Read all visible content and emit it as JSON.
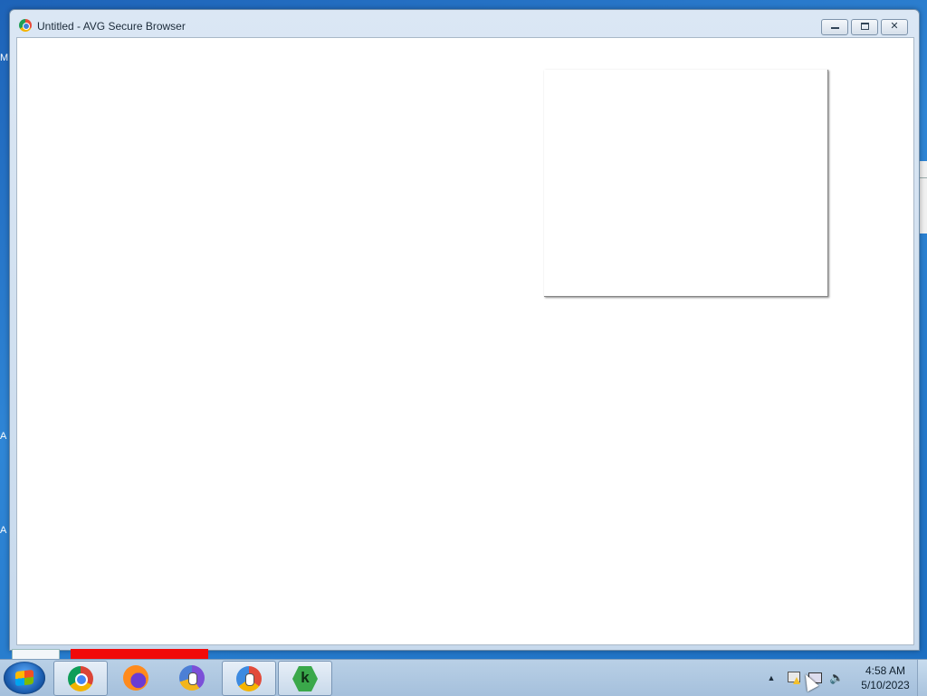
{
  "window": {
    "title": "Untitled - AVG Secure Browser",
    "buttons": {
      "minimize": "minimize",
      "maximize": "maximize",
      "close": "close"
    }
  },
  "desktop": {
    "edge_letters": [
      "M",
      "A",
      "A"
    ]
  },
  "taskbar": {
    "start": "start-orb",
    "items": [
      {
        "name": "Google Chrome",
        "icon": "chrome-icon",
        "active": true
      },
      {
        "name": "Firefox",
        "icon": "firefox-icon",
        "active": false
      },
      {
        "name": "AVG Secure Browser",
        "icon": "avg-browser-icon",
        "active": false
      },
      {
        "name": "AVG Secure Browser",
        "icon": "avg-browser-icon",
        "active": true
      },
      {
        "name": "Kaspersky",
        "icon": "kaspersky-icon",
        "active": true
      }
    ],
    "kaspersky_letter": "k",
    "tray": {
      "clock_time": "4:58 AM",
      "clock_date": "5/10/2023"
    }
  }
}
